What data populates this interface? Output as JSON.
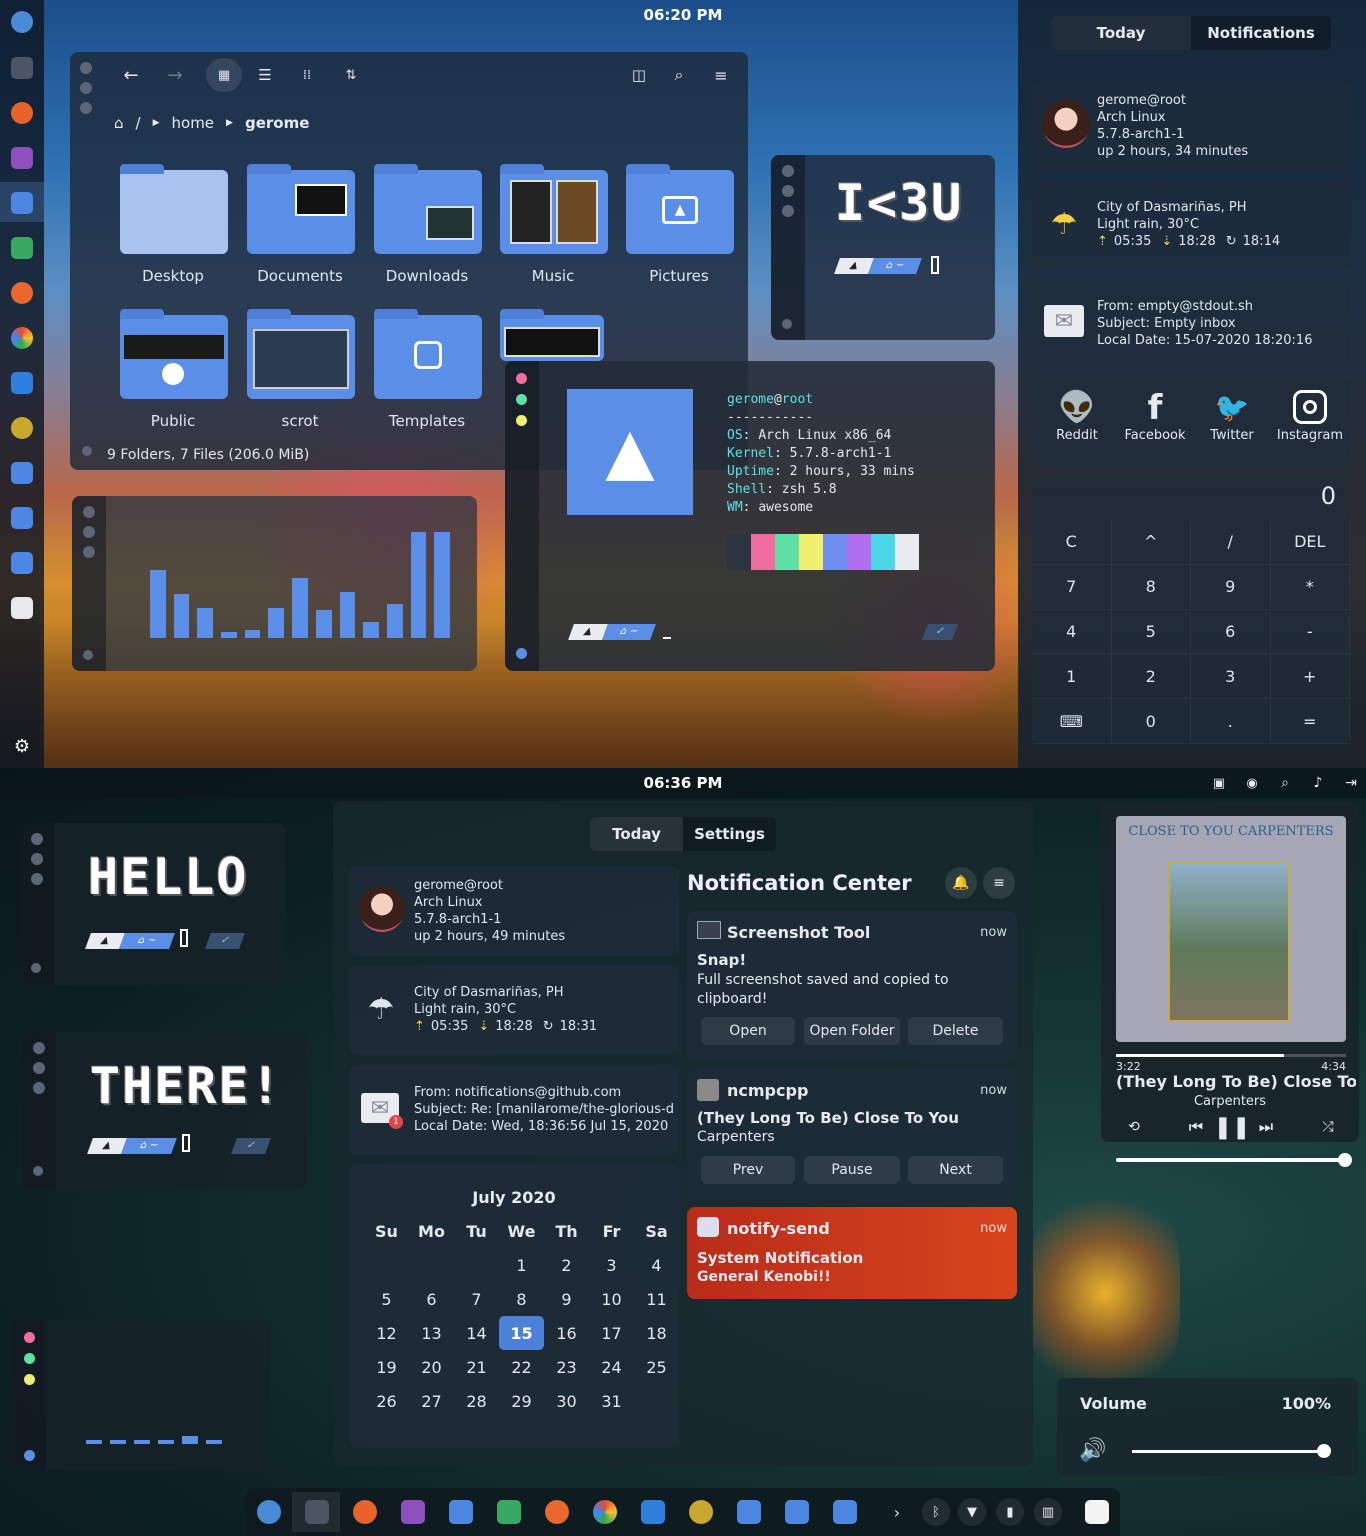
{
  "top": {
    "clock": "06:20 PM",
    "files": {
      "breadcrumb": [
        "/",
        "home",
        "gerome"
      ],
      "folders": [
        "Desktop",
        "Documents",
        "Downloads",
        "Music",
        "Pictures",
        "Public",
        "scrot",
        "Templates"
      ],
      "status": "9 Folders, 7 Files (206.0 MiB)"
    },
    "ik3u": "I<3U",
    "neofetch": {
      "user": "gerome",
      "host": "root",
      "rule": "-----------",
      "rows": [
        {
          "k": "OS",
          "v": "Arch Linux x86_64"
        },
        {
          "k": "Kernel",
          "v": "5.7.8-arch1-1"
        },
        {
          "k": "Uptime",
          "v": "2 hours, 33 mins"
        },
        {
          "k": "Shell",
          "v": "zsh 5.8"
        },
        {
          "k": "WM",
          "v": "awesome"
        }
      ],
      "colors": [
        "#2c3440",
        "#f06e9d",
        "#5ee0a7",
        "#f0f06e",
        "#6e8ef0",
        "#b06ef0",
        "#4cd6e8",
        "#e8ecf0"
      ]
    },
    "bars": [
      68,
      44,
      30,
      6,
      8,
      30,
      60,
      28,
      46,
      16,
      34,
      106,
      106
    ],
    "panel": {
      "tabs": [
        "Today",
        "Notifications"
      ],
      "user": [
        "gerome@root",
        "Arch Linux",
        "5.7.8-arch1-1",
        "up 2 hours, 34 minutes"
      ],
      "weather": [
        "City of Dasmariñas, PH",
        "Light rain, 30°C"
      ],
      "sun": [
        "05:35",
        "18:28",
        "18:14"
      ],
      "mail": [
        "From: empty@stdout.sh",
        "Subject: Empty inbox",
        "Local Date: 15-07-2020 18:20:16"
      ],
      "social": [
        "Reddit",
        "Facebook",
        "Twitter",
        "Instagram"
      ],
      "calc_display": "0",
      "calc_keys": [
        "C",
        "^",
        "/",
        "DEL",
        "7",
        "8",
        "9",
        "*",
        "4",
        "5",
        "6",
        "-",
        "1",
        "2",
        "3",
        "+",
        "kbd",
        "0",
        ".",
        "="
      ]
    }
  },
  "bottom": {
    "clock": "06:36 PM",
    "hello": "HELLO",
    "there": "THERE!",
    "center": {
      "tabs": [
        "Today",
        "Settings"
      ],
      "user": [
        "gerome@root",
        "Arch Linux",
        "5.7.8-arch1-1",
        "up 2 hours, 49 minutes"
      ],
      "weather": [
        "City of Dasmariñas, PH",
        "Light rain, 30°C"
      ],
      "sun": [
        "05:35",
        "18:28",
        "18:31"
      ],
      "mail": [
        "From: notifications@github.com",
        "Subject: Re: [manilarome/the-glorious-d",
        "Local Date: Wed, 18:36:56 Jul 15, 2020"
      ],
      "mail_badge": "1",
      "calendar": {
        "title": "July 2020",
        "headers": [
          "Su",
          "Mo",
          "Tu",
          "We",
          "Th",
          "Fr",
          "Sa"
        ],
        "weeks": [
          [
            "",
            "",
            "",
            "1",
            "2",
            "3",
            "4"
          ],
          [
            "5",
            "6",
            "7",
            "8",
            "9",
            "10",
            "11"
          ],
          [
            "12",
            "13",
            "14",
            "15",
            "16",
            "17",
            "18"
          ],
          [
            "19",
            "20",
            "21",
            "22",
            "23",
            "24",
            "25"
          ],
          [
            "26",
            "27",
            "28",
            "29",
            "30",
            "31",
            ""
          ]
        ],
        "today": "15"
      },
      "nc_title": "Notification Center",
      "notifs": [
        {
          "app": "Screenshot Tool",
          "time": "now",
          "title": "Snap!",
          "body": "Full screenshot saved and copied to clipboard!",
          "actions": [
            "Open",
            "Open Folder",
            "Delete"
          ]
        },
        {
          "app": "ncmpcpp",
          "time": "now",
          "title": "(They Long To Be) Close To You",
          "body": "Carpenters",
          "actions": [
            "Prev",
            "Pause",
            "Next"
          ]
        },
        {
          "app": "notify-send",
          "time": "now",
          "title": "System Notification",
          "body": "General Kenobi!!"
        }
      ]
    },
    "music": {
      "art_text": "CLOSE TO YOU CARPENTERS",
      "elapsed": "3:22",
      "total": "4:34",
      "progress": 0.73,
      "title": "(They Long To Be) Close To Y",
      "artist": "Carpenters"
    },
    "volume": {
      "label": "Volume",
      "value": "100%",
      "level": 1.0
    },
    "mini_bars": [
      1,
      1,
      1,
      1,
      2,
      1
    ]
  }
}
